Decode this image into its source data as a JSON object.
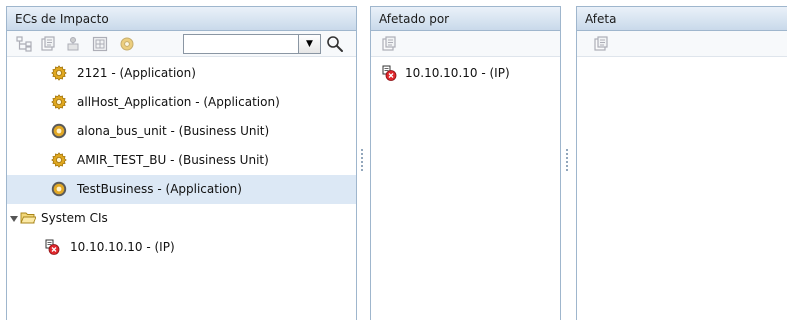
{
  "panels": {
    "impact": {
      "title": "ECs de Impacto",
      "toolbar": {
        "icons": [
          "hierarchy-icon",
          "properties-icon",
          "related-icon",
          "map-icon",
          "ci-type-icon"
        ],
        "search": {
          "value": "",
          "placeholder": ""
        }
      },
      "items": [
        {
          "label": "2121 - (Application)",
          "icon": "application-gear-icon",
          "selected": false
        },
        {
          "label": "allHost_Application - (Application)",
          "icon": "application-gear-icon",
          "selected": false
        },
        {
          "label": "alona_bus_unit - (Business Unit)",
          "icon": "business-unit-icon",
          "selected": false
        },
        {
          "label": "AMIR_TEST_BU - (Business Unit)",
          "icon": "application-gear-icon",
          "selected": false
        },
        {
          "label": "TestBusiness - (Application)",
          "icon": "business-unit-icon",
          "selected": true
        }
      ],
      "group": {
        "label": "System CIs",
        "expanded": true,
        "children": [
          {
            "label": "10.10.10.10 - (IP)",
            "icon": "ip-critical-icon"
          }
        ]
      }
    },
    "affected_by": {
      "title": "Afetado por",
      "items": [
        {
          "label": "10.10.10.10 - (IP)",
          "icon": "ip-critical-icon"
        }
      ]
    },
    "affects": {
      "title": "Afeta",
      "items": []
    }
  },
  "colors": {
    "header_border": "#9fb6cd",
    "selected_row": "#dce8f5",
    "gear": "#d9a21b",
    "critical": "#e0272c"
  }
}
